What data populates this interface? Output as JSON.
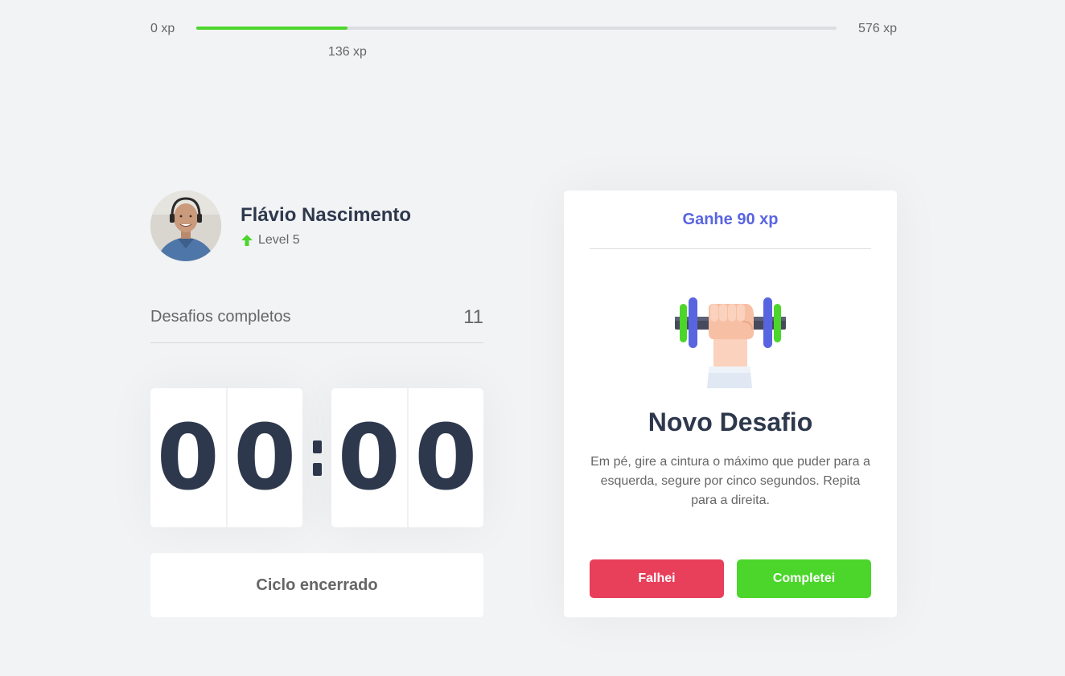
{
  "colors": {
    "background": "#f2f3f5",
    "text": "#666666",
    "title": "#2e384d",
    "blue": "#5965e0",
    "green": "#4cd62b",
    "red": "#e83f5b",
    "white": "#ffffff"
  },
  "xp_bar": {
    "min_label": "0 xp",
    "max_label": "576 xp",
    "current_label": "136 xp",
    "current_value": 136,
    "max_value": 576
  },
  "profile": {
    "name": "Flávio Nascimento",
    "level_label": "Level 5",
    "level_icon": "level-up-arrow-icon"
  },
  "completed_challenges": {
    "label": "Desafios completos",
    "count": "11"
  },
  "countdown": {
    "minute_left": "0",
    "minute_right": "0",
    "second_left": "0",
    "second_right": "0",
    "button_label": "Ciclo encerrado"
  },
  "challenge": {
    "header": "Ganhe 90 xp",
    "icon": "dumbbell-body-icon",
    "title": "Novo Desafio",
    "description": "Em pé, gire a cintura o máximo que puder para a esquerda, segure por cinco segundos. Repita para a direita.",
    "failed_label": "Falhei",
    "succeeded_label": "Completei"
  }
}
